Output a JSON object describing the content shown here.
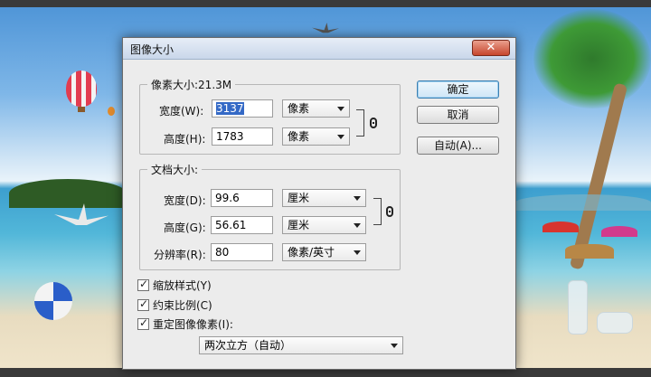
{
  "dialog": {
    "title": "图像大小",
    "close_label": "✕"
  },
  "pixel_dimensions": {
    "legend": "像素大小:21.3M",
    "width_label": "宽度(W):",
    "width_value": "3137",
    "width_unit": "像素",
    "height_label": "高度(H):",
    "height_value": "1783",
    "height_unit": "像素"
  },
  "document_size": {
    "legend": "文档大小:",
    "width_label": "宽度(D):",
    "width_value": "99.6",
    "width_unit": "厘米",
    "height_label": "高度(G):",
    "height_value": "56.61",
    "height_unit": "厘米",
    "resolution_label": "分辨率(R):",
    "resolution_value": "80",
    "resolution_unit": "像素/英寸"
  },
  "buttons": {
    "ok": "确定",
    "cancel": "取消",
    "auto": "自动(A)..."
  },
  "options": {
    "scale_styles": {
      "label": "缩放样式(Y)",
      "checked": true
    },
    "constrain_proportions": {
      "label": "约束比例(C)",
      "checked": true
    },
    "resample_image": {
      "label": "重定图像像素(I):",
      "checked": true
    },
    "resample_method": "两次立方（自动）"
  },
  "icons": [
    "close-icon",
    "chain-link-icon",
    "dropdown-arrow-icon",
    "checkmark-icon"
  ]
}
